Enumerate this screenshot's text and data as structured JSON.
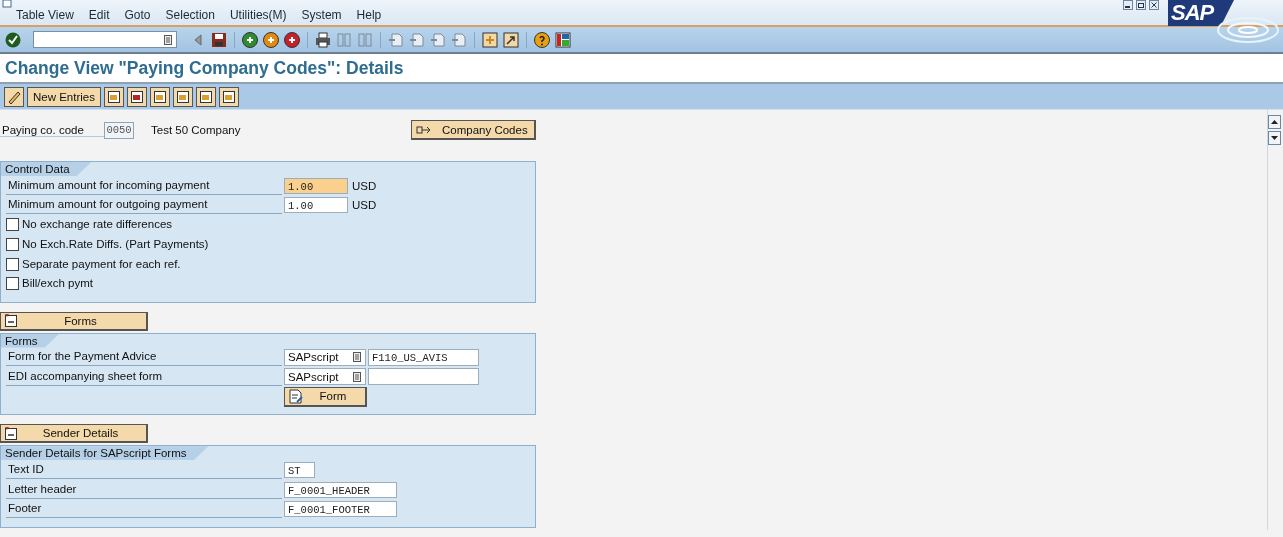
{
  "menu": [
    {
      "label": "Table View"
    },
    {
      "label": "Edit"
    },
    {
      "label": "Goto"
    },
    {
      "label": "Selection"
    },
    {
      "label": "Utilities(M)"
    },
    {
      "label": "System"
    },
    {
      "label": "Help"
    }
  ],
  "logo": "SAP",
  "title": "Change View \"Paying Company Codes\": Details",
  "app_toolbar": {
    "new_entries": "New Entries"
  },
  "header": {
    "label": "Paying co. code",
    "value": "0050",
    "description": "Test 50 Company",
    "button": "Company Codes"
  },
  "sections": [
    {
      "title": "Control Data",
      "rows": [
        {
          "kind": "amount",
          "label": "Minimum amount for incoming payment",
          "value": "1.00",
          "unit": "USD",
          "focused": true
        },
        {
          "kind": "amount",
          "label": "Minimum amount for outgoing payment",
          "value": "1.00",
          "unit": "USD",
          "focused": false
        },
        {
          "kind": "checkbox",
          "label": "No exchange rate differences",
          "checked": false
        },
        {
          "kind": "checkbox",
          "label": "No Exch.Rate Diffs. (Part Payments)",
          "checked": false
        },
        {
          "kind": "checkbox",
          "label": "Separate payment for each ref.",
          "checked": false
        },
        {
          "kind": "checkbox",
          "label": "Bill/exch pymt",
          "checked": false
        }
      ]
    },
    {
      "toggle": "Forms",
      "title": "Forms",
      "button": "Form",
      "rows": [
        {
          "kind": "form",
          "label": "Form for the Payment Advice",
          "type": "SAPscript",
          "value": "F110_US_AVIS"
        },
        {
          "kind": "form",
          "label": "EDI accompanying sheet form",
          "type": "SAPscript"
        }
      ]
    },
    {
      "toggle": "Sender Details",
      "title": "Sender Details for SAPscript Forms",
      "rows": [
        {
          "kind": "text",
          "label": "Text ID",
          "value": "ST"
        },
        {
          "kind": "text",
          "label": "Letter header",
          "value": "F_0001_HEADER"
        },
        {
          "kind": "text",
          "label": "Footer",
          "value": "F_0001_FOOTER"
        }
      ]
    }
  ]
}
